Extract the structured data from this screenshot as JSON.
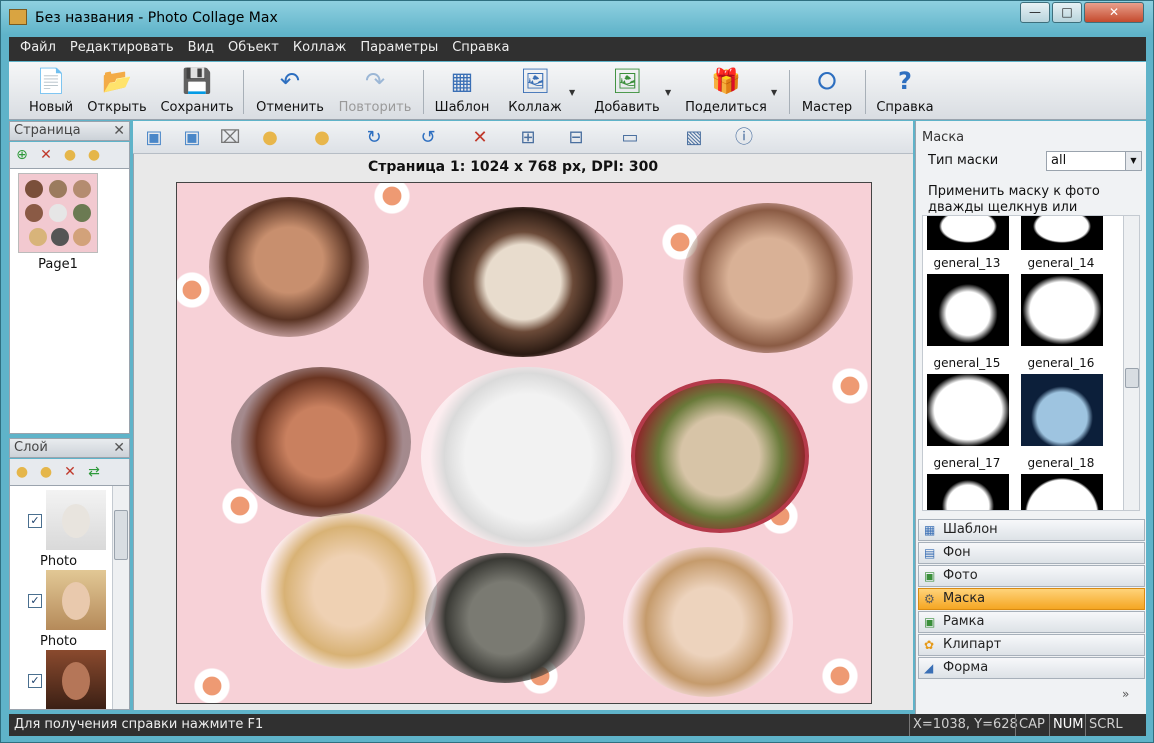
{
  "window": {
    "title": "Без названия - Photo Collage Max",
    "minimize": "—",
    "maximize": "□",
    "close": "✕"
  },
  "menu": [
    "Файл",
    "Редактировать",
    "Вид",
    "Объект",
    "Коллаж",
    "Параметры",
    "Справка"
  ],
  "toolbar": {
    "new": "Новый",
    "open": "Открыть",
    "save": "Сохранить",
    "undo": "Отменить",
    "redo": "Повторить",
    "template": "Шаблон",
    "collage": "Коллаж",
    "add": "Добавить",
    "share": "Поделиться",
    "wizard": "Мастер",
    "help": "Справка"
  },
  "page_panel": {
    "title": "Страница",
    "close": "✕",
    "page_label": "Page1"
  },
  "layer_panel": {
    "title": "Слой",
    "close": "✕",
    "items": [
      {
        "label": "Photo",
        "checked": "✓"
      },
      {
        "label": "Photo",
        "checked": "✓"
      },
      {
        "label": "",
        "checked": "✓"
      }
    ]
  },
  "canvas": {
    "page_info": "Страница 1: 1024 x 768 px, DPI: 300"
  },
  "mask_panel": {
    "title": "Маска",
    "type_label": "Тип маски",
    "type_value": "all",
    "hint_line1": "Применить маску к фото",
    "hint_line2": "дважды щелкнув или",
    "masks": [
      "general_13",
      "general_14",
      "general_15",
      "general_16",
      "general_17",
      "general_18"
    ]
  },
  "accordion": [
    "Шаблон",
    "Фон",
    "Фото",
    "Маска",
    "Рамка",
    "Клипарт",
    "Форма"
  ],
  "accordion_active": "Маска",
  "accordion_more": "»",
  "status": {
    "help": "Для получения справки нажмите F1",
    "coords": "X=1038, Y=628",
    "cap": "CAP",
    "num": "NUM",
    "scrl": "SCRL"
  },
  "colors": {
    "accent": "#f5a623",
    "titlebar": "#5fb3c9",
    "menubar": "#303030",
    "canvas_bg": "#f7d1d7"
  }
}
